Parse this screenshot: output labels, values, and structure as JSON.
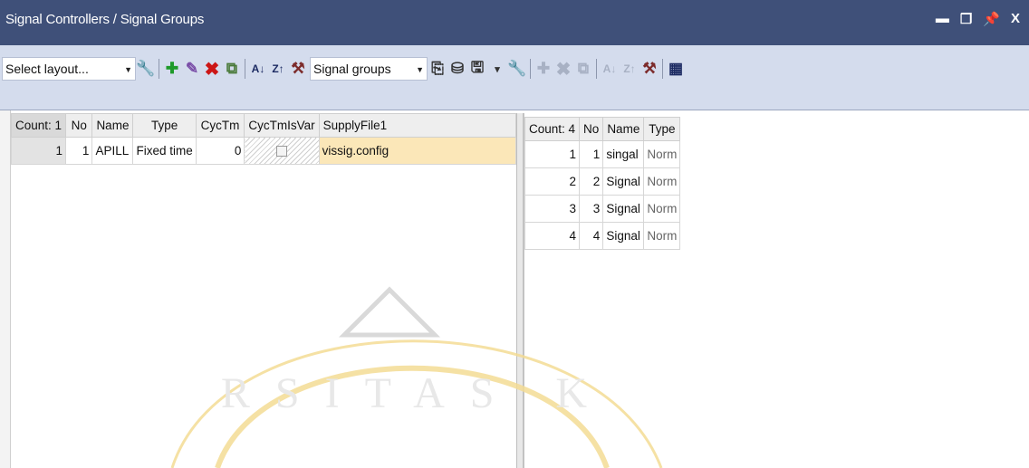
{
  "window": {
    "title": "Signal Controllers / Signal Groups",
    "controls": [
      "▬",
      "❐",
      "📌",
      "X"
    ]
  },
  "toolbar_left": {
    "layout_select": "Select layout...",
    "icons": [
      "wrench-icon",
      "add-icon",
      "edit-icon",
      "delete-icon",
      "duplicate-icon",
      "sort-asc-icon",
      "sort-desc-icon",
      "clear-sort-icon"
    ]
  },
  "toolbar_right": {
    "list_select": "Signal groups",
    "icons": [
      "copy-icon",
      "database-icon",
      "save-icon",
      "wrench-icon",
      "add-icon",
      "delete-icon",
      "duplicate-icon",
      "sort-asc-icon",
      "sort-desc-icon",
      "clear-sort-icon",
      "grid-add-icon"
    ]
  },
  "left_table": {
    "headers": [
      "Count: 1",
      "No",
      "Name",
      "Type",
      "CycTm",
      "CycTmIsVar",
      "SupplyFile1"
    ],
    "rows": [
      {
        "idx": "1",
        "no": "1",
        "name": "APILL",
        "type": "Fixed time",
        "cyctm": "0",
        "supply": "vissig.config"
      }
    ]
  },
  "right_table": {
    "headers": [
      "Count: 4",
      "No",
      "Name",
      "Type"
    ],
    "rows": [
      {
        "idx": "1",
        "no": "1",
        "name": "singal",
        "type": "Norm"
      },
      {
        "idx": "2",
        "no": "2",
        "name": "Signal",
        "type": "Norm"
      },
      {
        "idx": "3",
        "no": "3",
        "name": "Signal",
        "type": "Norm"
      },
      {
        "idx": "4",
        "no": "4",
        "name": "Signal",
        "type": "Norm"
      }
    ]
  },
  "watermark": {
    "text": "RSITAS K"
  },
  "colors": {
    "titlebar": "#3f5079",
    "toolbar": "#d4dced",
    "selected_cell": "#fbe7b8",
    "watermark": "#f2d37a"
  }
}
